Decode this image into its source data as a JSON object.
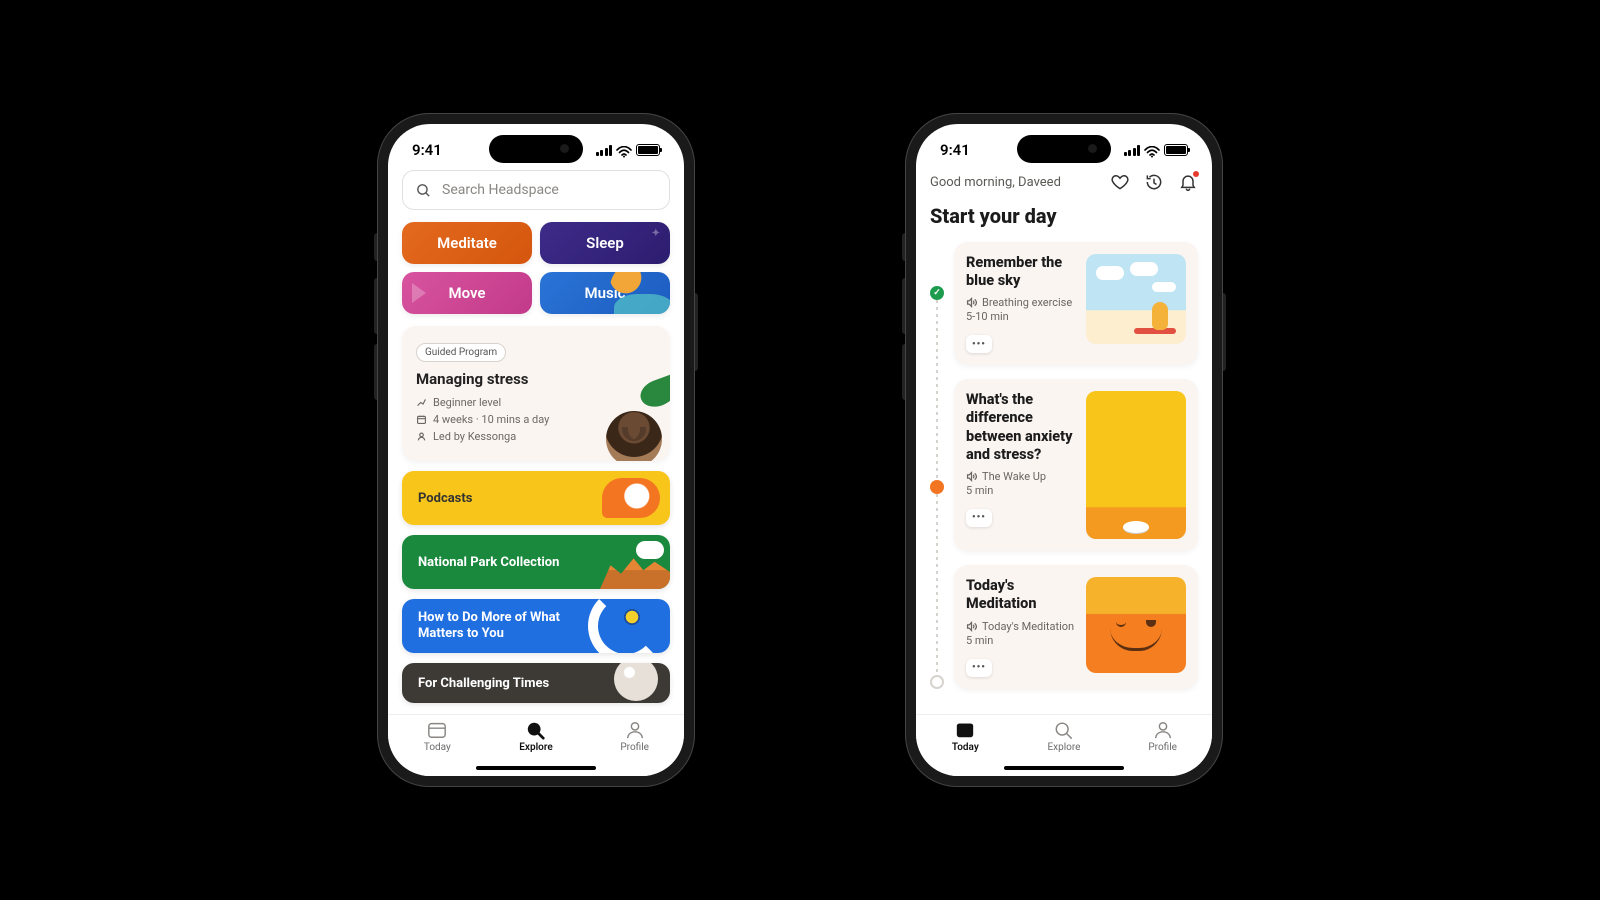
{
  "status": {
    "time": "9:41"
  },
  "explore": {
    "search_placeholder": "Search Headspace",
    "categories": {
      "meditate": "Meditate",
      "sleep": "Sleep",
      "move": "Move",
      "music": "Music"
    },
    "program": {
      "chip": "Guided Program",
      "title": "Managing stress",
      "level": "Beginner level",
      "duration": "4 weeks · 10 mins a day",
      "led_by": "Led by Kessonga"
    },
    "strips": {
      "podcasts": "Podcasts",
      "parks": "National Park Collection",
      "how": "How to Do More of What Matters to You",
      "challenging": "For Challenging Times"
    }
  },
  "today": {
    "greeting": "Good morning, Daveed",
    "heading": "Start your day",
    "cards": [
      {
        "title": "Remember the blue sky",
        "sub": "Breathing exercise",
        "duration": "5-10 min"
      },
      {
        "title": "What's the difference between anxiety and stress?",
        "sub": "The Wake Up",
        "duration": "5 min"
      },
      {
        "title": "Today's Meditation",
        "sub": "Today's Meditation",
        "duration": "5 min"
      }
    ]
  },
  "tabs": {
    "today": "Today",
    "explore": "Explore",
    "profile": "Profile"
  }
}
